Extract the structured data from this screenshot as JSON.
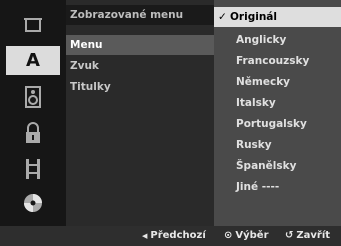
{
  "sidebar": {
    "icons": [
      {
        "name": "disc-menu-icon"
      },
      {
        "name": "language-icon",
        "glyph": "A"
      },
      {
        "name": "audio-speaker-icon"
      },
      {
        "name": "lock-icon"
      },
      {
        "name": "film-strip-icon"
      },
      {
        "name": "misc-disc-icon"
      }
    ]
  },
  "menu": {
    "header": "Zobrazované menu",
    "items": [
      "Menu",
      "Zvuk",
      "Titulky"
    ]
  },
  "options": {
    "checked_mark": "✓",
    "items": [
      "Originál",
      "Anglicky",
      "Francouzsky",
      "Německy",
      "Italsky",
      "Portugalsky",
      "Rusky",
      "Španělsky",
      "Jiné ----"
    ]
  },
  "footer": {
    "prev_glyph": "◀",
    "prev_label": "Předchozí",
    "select_glyph": "⊙",
    "select_label": "Výběr",
    "close_glyph": "↺",
    "close_label": "Zavřít"
  }
}
